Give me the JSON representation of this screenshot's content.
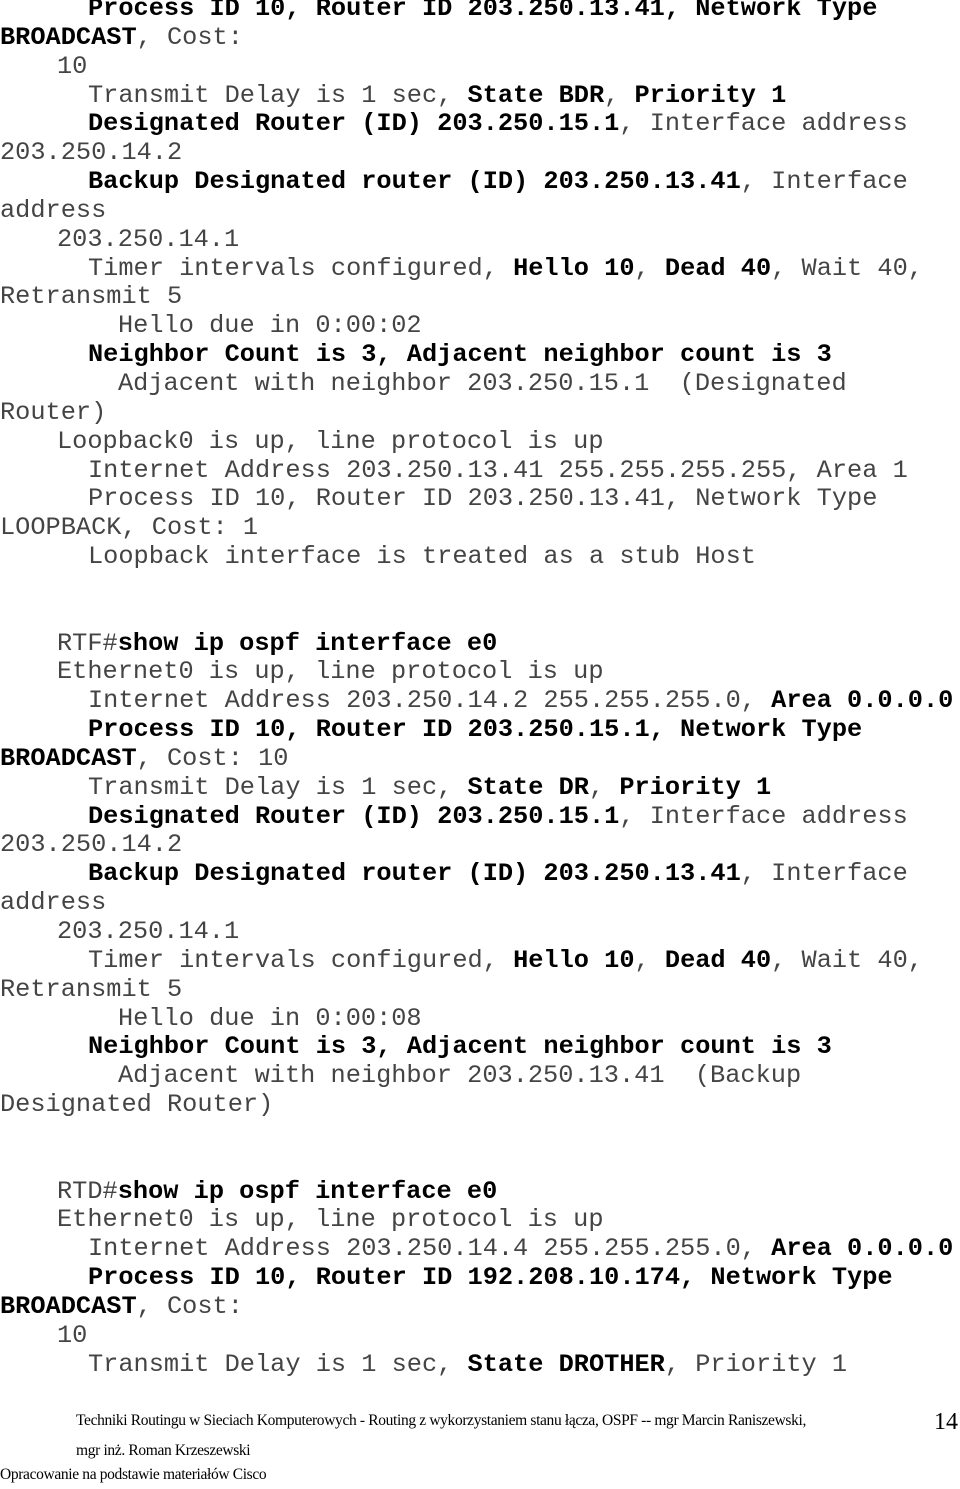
{
  "document": {
    "lines": [
      {
        "indent": 2,
        "segments": [
          {
            "t": "Process ID 10, Router ID 203.250.13.41, Network Type",
            "b": true
          }
        ]
      },
      {
        "indent": 0,
        "segments": [
          {
            "t": "BROADCAST",
            "b": true
          },
          {
            "t": ", Cost:",
            "b": false
          }
        ]
      },
      {
        "indent": 1,
        "segments": [
          {
            "t": "10",
            "b": false
          }
        ]
      },
      {
        "indent": 2,
        "segments": [
          {
            "t": "Transmit Delay is 1 sec, ",
            "b": false
          },
          {
            "t": "State BDR",
            "b": true
          },
          {
            "t": ", ",
            "b": false
          },
          {
            "t": "Priority 1",
            "b": true
          }
        ]
      },
      {
        "indent": 2,
        "segments": [
          {
            "t": "Designated Router (ID) 203.250.15.1",
            "b": true
          },
          {
            "t": ", Interface address",
            "b": false
          }
        ]
      },
      {
        "indent": 0,
        "segments": [
          {
            "t": "203.250.14.2",
            "b": false
          }
        ]
      },
      {
        "indent": 2,
        "segments": [
          {
            "t": "Backup Designated router (ID) 203.250.13.41",
            "b": true
          },
          {
            "t": ", Interface",
            "b": false
          }
        ]
      },
      {
        "indent": 0,
        "segments": [
          {
            "t": "address",
            "b": false
          }
        ]
      },
      {
        "indent": 1,
        "segments": [
          {
            "t": "203.250.14.1",
            "b": false
          }
        ]
      },
      {
        "indent": 2,
        "segments": [
          {
            "t": "Timer intervals configured, ",
            "b": false
          },
          {
            "t": "Hello 10",
            "b": true
          },
          {
            "t": ", ",
            "b": false
          },
          {
            "t": "Dead 40",
            "b": true
          },
          {
            "t": ", Wait 40,",
            "b": false
          }
        ]
      },
      {
        "indent": 0,
        "segments": [
          {
            "t": "Retransmit 5",
            "b": false
          }
        ]
      },
      {
        "indent": 3,
        "segments": [
          {
            "t": "Hello due in 0:00:02",
            "b": false
          }
        ]
      },
      {
        "indent": 2,
        "segments": [
          {
            "t": "Neighbor Count is 3, Adjacent neighbor count is 3",
            "b": true
          }
        ]
      },
      {
        "indent": 3,
        "segments": [
          {
            "t": "Adjacent with neighbor 203.250.15.1  (Designated",
            "b": false
          }
        ]
      },
      {
        "indent": 0,
        "segments": [
          {
            "t": "Router)",
            "b": false
          }
        ]
      },
      {
        "indent": 1,
        "segments": [
          {
            "t": "Loopback0 is up, line protocol is up",
            "b": false
          }
        ]
      },
      {
        "indent": 2,
        "segments": [
          {
            "t": "Internet Address 203.250.13.41 255.255.255.255, Area 1",
            "b": false
          }
        ]
      },
      {
        "indent": 2,
        "segments": [
          {
            "t": "Process ID 10, Router ID 203.250.13.41, Network Type",
            "b": false
          }
        ]
      },
      {
        "indent": 0,
        "segments": [
          {
            "t": "LOOPBACK, Cost: 1",
            "b": false
          }
        ]
      },
      {
        "indent": 2,
        "segments": [
          {
            "t": "Loopback interface is treated as a stub Host",
            "b": false
          }
        ]
      },
      {
        "indent": 0,
        "segments": []
      },
      {
        "indent": 0,
        "segments": []
      },
      {
        "indent": 1,
        "segments": [
          {
            "t": "RTF#",
            "b": false
          },
          {
            "t": "show ip ospf interface e0",
            "b": true
          }
        ]
      },
      {
        "indent": 1,
        "segments": [
          {
            "t": "Ethernet0 is up, line protocol is up",
            "b": false
          }
        ]
      },
      {
        "indent": 2,
        "segments": [
          {
            "t": "Internet Address 203.250.14.2 255.255.255.0, ",
            "b": false
          },
          {
            "t": "Area 0.0.0.0",
            "b": true
          }
        ]
      },
      {
        "indent": 2,
        "segments": [
          {
            "t": "Process ID 10, Router ID 203.250.15.1, Network Type",
            "b": true
          }
        ]
      },
      {
        "indent": 0,
        "segments": [
          {
            "t": "BROADCAST",
            "b": true
          },
          {
            "t": ", Cost: 10",
            "b": false
          }
        ]
      },
      {
        "indent": 2,
        "segments": [
          {
            "t": "Transmit Delay is 1 sec, ",
            "b": false
          },
          {
            "t": "State DR",
            "b": true
          },
          {
            "t": ", ",
            "b": false
          },
          {
            "t": "Priority 1",
            "b": true
          }
        ]
      },
      {
        "indent": 2,
        "segments": [
          {
            "t": "Designated Router (ID) 203.250.15.1",
            "b": true
          },
          {
            "t": ", Interface address",
            "b": false
          }
        ]
      },
      {
        "indent": 0,
        "segments": [
          {
            "t": "203.250.14.2",
            "b": false
          }
        ]
      },
      {
        "indent": 2,
        "segments": [
          {
            "t": "Backup Designated router (ID) 203.250.13.41",
            "b": true
          },
          {
            "t": ", Interface",
            "b": false
          }
        ]
      },
      {
        "indent": 0,
        "segments": [
          {
            "t": "address",
            "b": false
          }
        ]
      },
      {
        "indent": 1,
        "segments": [
          {
            "t": "203.250.14.1",
            "b": false
          }
        ]
      },
      {
        "indent": 2,
        "segments": [
          {
            "t": "Timer intervals configured, ",
            "b": false
          },
          {
            "t": "Hello 10",
            "b": true
          },
          {
            "t": ", ",
            "b": false
          },
          {
            "t": "Dead 40",
            "b": true
          },
          {
            "t": ", Wait 40,",
            "b": false
          }
        ]
      },
      {
        "indent": 0,
        "segments": [
          {
            "t": "Retransmit 5",
            "b": false
          }
        ]
      },
      {
        "indent": 3,
        "segments": [
          {
            "t": "Hello due in 0:00:08",
            "b": false
          }
        ]
      },
      {
        "indent": 2,
        "segments": [
          {
            "t": "Neighbor Count is 3, Adjacent neighbor count is 3",
            "b": true
          }
        ]
      },
      {
        "indent": 3,
        "segments": [
          {
            "t": "Adjacent with neighbor 203.250.13.41  (Backup",
            "b": false
          }
        ]
      },
      {
        "indent": 0,
        "segments": [
          {
            "t": "Designated Router)",
            "b": false
          }
        ]
      },
      {
        "indent": 0,
        "segments": []
      },
      {
        "indent": 0,
        "segments": []
      },
      {
        "indent": 1,
        "segments": [
          {
            "t": "RTD#",
            "b": false
          },
          {
            "t": "show ip ospf interface e0",
            "b": true
          }
        ]
      },
      {
        "indent": 1,
        "segments": [
          {
            "t": "Ethernet0 is up, line protocol is up",
            "b": false
          }
        ]
      },
      {
        "indent": 2,
        "segments": [
          {
            "t": "Internet Address 203.250.14.4 255.255.255.0, ",
            "b": false
          },
          {
            "t": "Area 0.0.0.0",
            "b": true
          }
        ]
      },
      {
        "indent": 2,
        "segments": [
          {
            "t": "Process ID 10, Router ID 192.208.10.174, Network Type",
            "b": true
          }
        ]
      },
      {
        "indent": 0,
        "segments": [
          {
            "t": "BROADCAST",
            "b": true
          },
          {
            "t": ", Cost:",
            "b": false
          }
        ]
      },
      {
        "indent": 1,
        "segments": [
          {
            "t": "10",
            "b": false
          }
        ]
      },
      {
        "indent": 2,
        "segments": [
          {
            "t": "Transmit Delay is 1 sec, ",
            "b": false
          },
          {
            "t": "State DROTHER",
            "b": true
          },
          {
            "t": ", Priority 1",
            "b": false
          }
        ]
      }
    ]
  },
  "footer": {
    "title_line_1": "Techniki Routingu w Sieciach Komputerowych - Routing z wykorzystaniem stanu łącza, OSPF -- mgr Marcin Raniszewski,",
    "title_line_2": "mgr inż. Roman Krzeszewski",
    "source": "Opracowanie na podstawie materiałów Cisco",
    "page_number": "14"
  }
}
